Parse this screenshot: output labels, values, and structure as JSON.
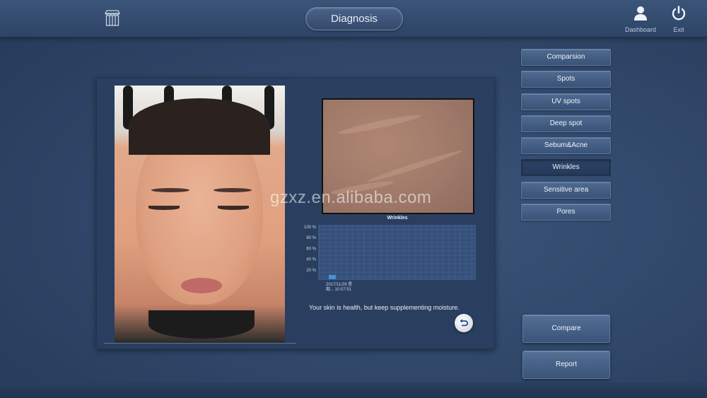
{
  "header": {
    "title": "Diagnosis",
    "dashboard_label": "Dashboard",
    "exit_label": "Exit"
  },
  "sidebar": {
    "items": [
      {
        "label": "Comparsion",
        "active": false
      },
      {
        "label": "Spots",
        "active": false
      },
      {
        "label": "UV spots",
        "active": false
      },
      {
        "label": "Deep spot",
        "active": false
      },
      {
        "label": "Sebum&Acne",
        "active": false
      },
      {
        "label": "Wrinkles",
        "active": true
      },
      {
        "label": "Sensitive area",
        "active": false
      },
      {
        "label": "Pores",
        "active": false
      }
    ],
    "compare_label": "Compare",
    "report_label": "Report"
  },
  "chart_data": {
    "type": "bar",
    "title": "Wrinkles",
    "y_ticks": [
      "100 %",
      "80 %",
      "60 %",
      "40 %",
      "20 %"
    ],
    "ylim": [
      0,
      100
    ],
    "categories": [
      "2017/11/29 ..."
    ],
    "x_tick_lines": [
      "2017/11/29 星",
      "期...  10:07:51"
    ],
    "values": [
      8
    ],
    "grid": true,
    "bar_color": "#4a8fd6"
  },
  "diagnosis": {
    "message": "Your skin is health, but keep supplementing moisture."
  },
  "watermark": "gzxz.en.alibaba.com",
  "colors": {
    "background": "#2f4668",
    "button": "#46618a",
    "active_button": "#27405f"
  }
}
